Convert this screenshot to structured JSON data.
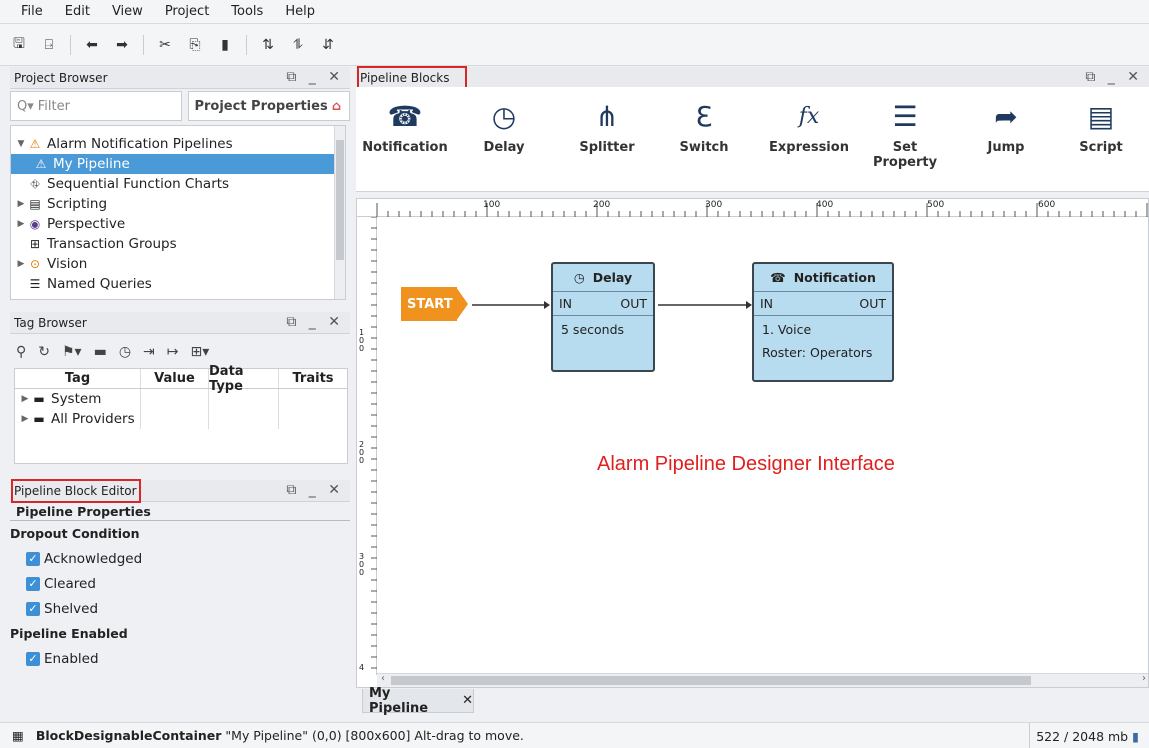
{
  "menu": [
    "File",
    "Edit",
    "View",
    "Project",
    "Tools",
    "Help"
  ],
  "project_browser": {
    "title": "Project Browser",
    "filter_placeholder": "Filter",
    "project_properties": "Project Properties",
    "tree": [
      "Alarm Notification Pipelines",
      "My Pipeline",
      "Sequential Function Charts",
      "Scripting",
      "Perspective",
      "Transaction Groups",
      "Vision",
      "Named Queries"
    ]
  },
  "tag_browser": {
    "title": "Tag Browser",
    "columns": [
      "Tag",
      "Value",
      "Data Type",
      "Traits"
    ],
    "rows": [
      "System",
      "All Providers"
    ]
  },
  "pipeline_block_editor": {
    "title": "Pipeline Block Editor",
    "section": "Pipeline Properties",
    "dropout_condition": "Dropout Condition",
    "checks": [
      "Acknowledged",
      "Cleared",
      "Shelved"
    ],
    "pipeline_enabled": "Pipeline Enabled",
    "enabled": "Enabled"
  },
  "pipeline_blocks": {
    "title": "Pipeline Blocks",
    "items": [
      "Notification",
      "Delay",
      "Splitter",
      "Switch",
      "Expression",
      "Set Property",
      "Jump",
      "Script"
    ]
  },
  "canvas": {
    "ruler_ticks": [
      "100",
      "200",
      "300",
      "400",
      "500",
      "600"
    ],
    "ruler_left": [
      "1 0 0",
      "2 0 0",
      "3 0 0",
      "4"
    ],
    "start": "START",
    "delay_block": {
      "title": "Delay",
      "in": "IN",
      "out": "OUT",
      "line1": "5 seconds"
    },
    "notification_block": {
      "title": "Notification",
      "in": "IN",
      "out": "OUT",
      "line1": "1. Voice",
      "line2": "Roster: Operators"
    },
    "annotation": "Alarm Pipeline Designer Interface"
  },
  "document_tab": "My Pipeline",
  "status": {
    "component": "BlockDesignableContainer",
    "detail": "\"My Pipeline\" (0,0) [800x600] Alt-drag to move.",
    "memory": "522 / 2048 mb"
  }
}
